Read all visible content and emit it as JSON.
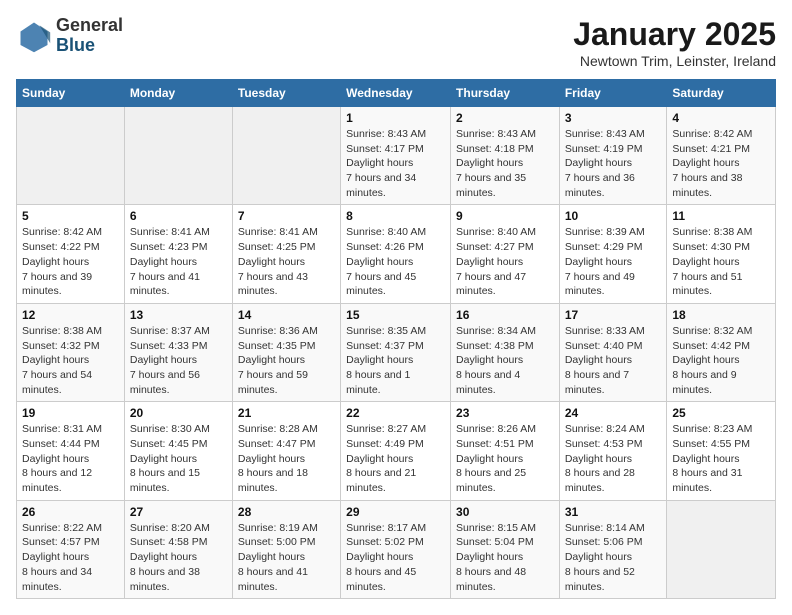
{
  "header": {
    "logo_general": "General",
    "logo_blue": "Blue",
    "month": "January 2025",
    "location": "Newtown Trim, Leinster, Ireland"
  },
  "weekdays": [
    "Sunday",
    "Monday",
    "Tuesday",
    "Wednesday",
    "Thursday",
    "Friday",
    "Saturday"
  ],
  "weeks": [
    [
      {
        "day": "",
        "empty": true
      },
      {
        "day": "",
        "empty": true
      },
      {
        "day": "",
        "empty": true
      },
      {
        "day": "1",
        "sunrise": "8:43 AM",
        "sunset": "4:17 PM",
        "daylight": "7 hours and 34 minutes."
      },
      {
        "day": "2",
        "sunrise": "8:43 AM",
        "sunset": "4:18 PM",
        "daylight": "7 hours and 35 minutes."
      },
      {
        "day": "3",
        "sunrise": "8:43 AM",
        "sunset": "4:19 PM",
        "daylight": "7 hours and 36 minutes."
      },
      {
        "day": "4",
        "sunrise": "8:42 AM",
        "sunset": "4:21 PM",
        "daylight": "7 hours and 38 minutes."
      }
    ],
    [
      {
        "day": "5",
        "sunrise": "8:42 AM",
        "sunset": "4:22 PM",
        "daylight": "7 hours and 39 minutes."
      },
      {
        "day": "6",
        "sunrise": "8:41 AM",
        "sunset": "4:23 PM",
        "daylight": "7 hours and 41 minutes."
      },
      {
        "day": "7",
        "sunrise": "8:41 AM",
        "sunset": "4:25 PM",
        "daylight": "7 hours and 43 minutes."
      },
      {
        "day": "8",
        "sunrise": "8:40 AM",
        "sunset": "4:26 PM",
        "daylight": "7 hours and 45 minutes."
      },
      {
        "day": "9",
        "sunrise": "8:40 AM",
        "sunset": "4:27 PM",
        "daylight": "7 hours and 47 minutes."
      },
      {
        "day": "10",
        "sunrise": "8:39 AM",
        "sunset": "4:29 PM",
        "daylight": "7 hours and 49 minutes."
      },
      {
        "day": "11",
        "sunrise": "8:38 AM",
        "sunset": "4:30 PM",
        "daylight": "7 hours and 51 minutes."
      }
    ],
    [
      {
        "day": "12",
        "sunrise": "8:38 AM",
        "sunset": "4:32 PM",
        "daylight": "7 hours and 54 minutes."
      },
      {
        "day": "13",
        "sunrise": "8:37 AM",
        "sunset": "4:33 PM",
        "daylight": "7 hours and 56 minutes."
      },
      {
        "day": "14",
        "sunrise": "8:36 AM",
        "sunset": "4:35 PM",
        "daylight": "7 hours and 59 minutes."
      },
      {
        "day": "15",
        "sunrise": "8:35 AM",
        "sunset": "4:37 PM",
        "daylight": "8 hours and 1 minute."
      },
      {
        "day": "16",
        "sunrise": "8:34 AM",
        "sunset": "4:38 PM",
        "daylight": "8 hours and 4 minutes."
      },
      {
        "day": "17",
        "sunrise": "8:33 AM",
        "sunset": "4:40 PM",
        "daylight": "8 hours and 7 minutes."
      },
      {
        "day": "18",
        "sunrise": "8:32 AM",
        "sunset": "4:42 PM",
        "daylight": "8 hours and 9 minutes."
      }
    ],
    [
      {
        "day": "19",
        "sunrise": "8:31 AM",
        "sunset": "4:44 PM",
        "daylight": "8 hours and 12 minutes."
      },
      {
        "day": "20",
        "sunrise": "8:30 AM",
        "sunset": "4:45 PM",
        "daylight": "8 hours and 15 minutes."
      },
      {
        "day": "21",
        "sunrise": "8:28 AM",
        "sunset": "4:47 PM",
        "daylight": "8 hours and 18 minutes."
      },
      {
        "day": "22",
        "sunrise": "8:27 AM",
        "sunset": "4:49 PM",
        "daylight": "8 hours and 21 minutes."
      },
      {
        "day": "23",
        "sunrise": "8:26 AM",
        "sunset": "4:51 PM",
        "daylight": "8 hours and 25 minutes."
      },
      {
        "day": "24",
        "sunrise": "8:24 AM",
        "sunset": "4:53 PM",
        "daylight": "8 hours and 28 minutes."
      },
      {
        "day": "25",
        "sunrise": "8:23 AM",
        "sunset": "4:55 PM",
        "daylight": "8 hours and 31 minutes."
      }
    ],
    [
      {
        "day": "26",
        "sunrise": "8:22 AM",
        "sunset": "4:57 PM",
        "daylight": "8 hours and 34 minutes."
      },
      {
        "day": "27",
        "sunrise": "8:20 AM",
        "sunset": "4:58 PM",
        "daylight": "8 hours and 38 minutes."
      },
      {
        "day": "28",
        "sunrise": "8:19 AM",
        "sunset": "5:00 PM",
        "daylight": "8 hours and 41 minutes."
      },
      {
        "day": "29",
        "sunrise": "8:17 AM",
        "sunset": "5:02 PM",
        "daylight": "8 hours and 45 minutes."
      },
      {
        "day": "30",
        "sunrise": "8:15 AM",
        "sunset": "5:04 PM",
        "daylight": "8 hours and 48 minutes."
      },
      {
        "day": "31",
        "sunrise": "8:14 AM",
        "sunset": "5:06 PM",
        "daylight": "8 hours and 52 minutes."
      },
      {
        "day": "",
        "empty": true
      }
    ]
  ]
}
